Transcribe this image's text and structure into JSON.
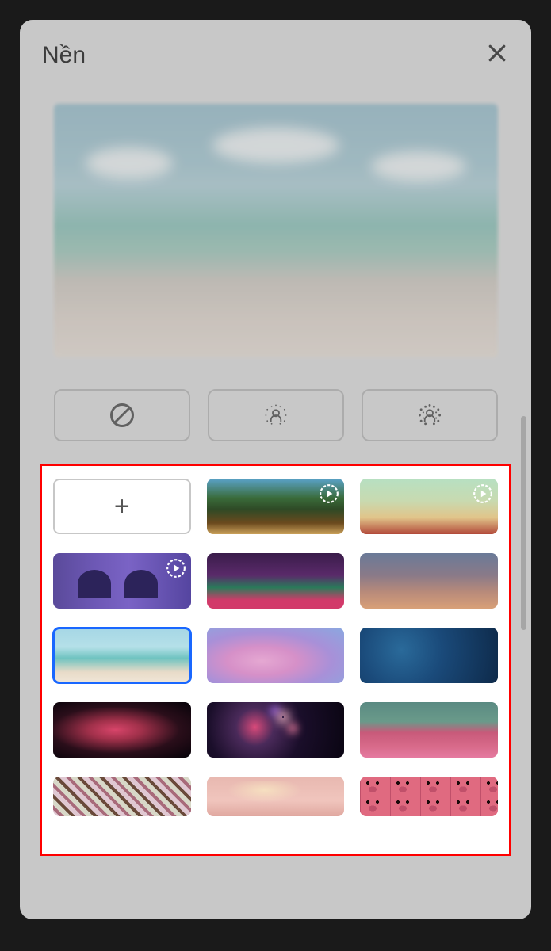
{
  "header": {
    "title": "Nền"
  },
  "options": {
    "none": "no-effect-icon",
    "blur_light": "blur-light-icon",
    "blur_strong": "blur-strong-icon"
  },
  "backgrounds": {
    "add_label": "+",
    "items": [
      {
        "id": "add",
        "type": "add"
      },
      {
        "id": "forest",
        "video": true
      },
      {
        "id": "classroom",
        "video": true
      },
      {
        "id": "purple-room",
        "video": true
      },
      {
        "id": "carnival",
        "video": false
      },
      {
        "id": "sunset",
        "video": false
      },
      {
        "id": "beach",
        "video": false,
        "selected": true
      },
      {
        "id": "pink-clouds",
        "video": false
      },
      {
        "id": "water",
        "video": false
      },
      {
        "id": "nebula",
        "video": false
      },
      {
        "id": "fireworks",
        "video": false
      },
      {
        "id": "flowers",
        "video": false
      },
      {
        "id": "blossoms",
        "video": false
      },
      {
        "id": "pink-soft",
        "video": false
      },
      {
        "id": "pigs",
        "video": false
      }
    ]
  }
}
